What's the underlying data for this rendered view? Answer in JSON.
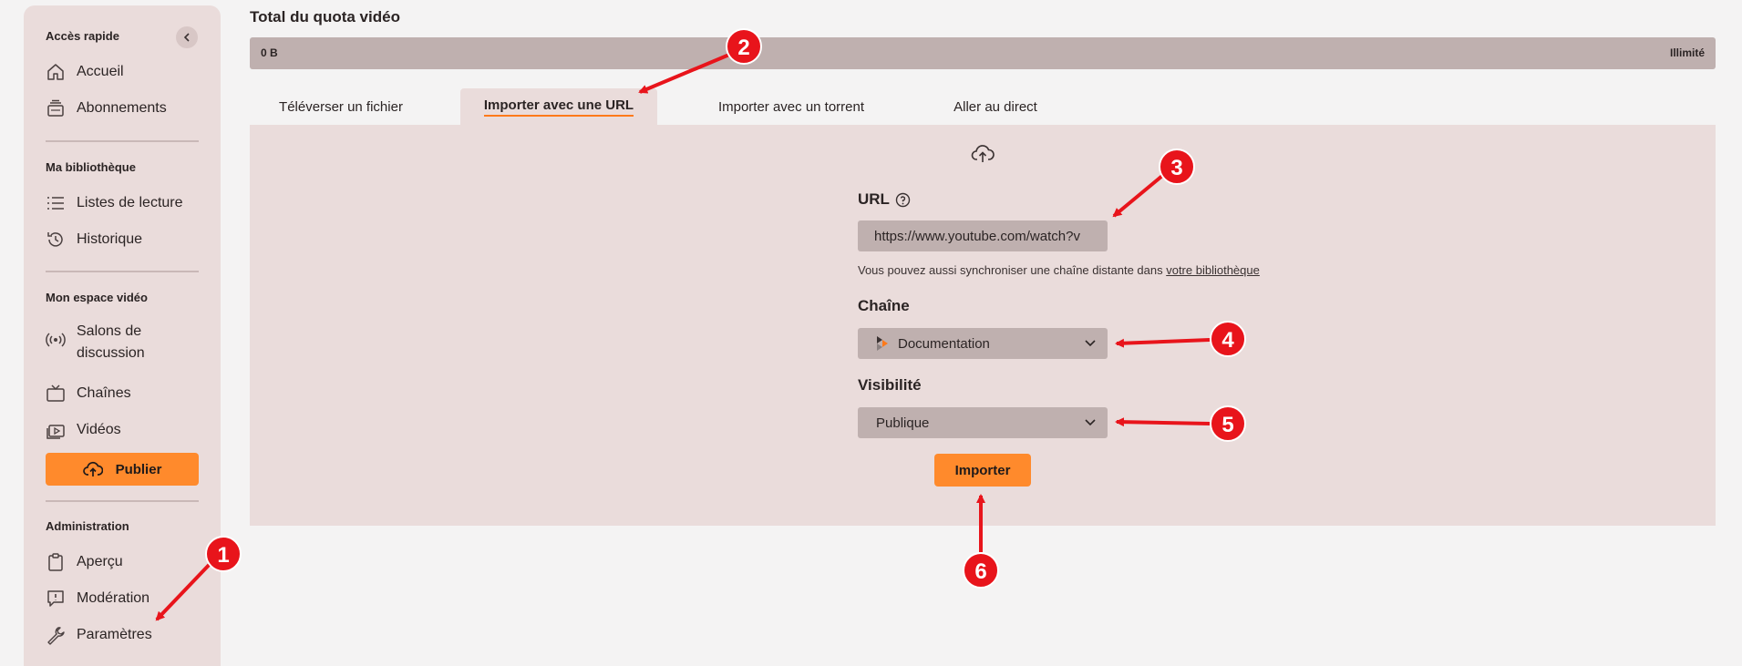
{
  "sidebar": {
    "quick_access_title": "Accès rapide",
    "quick_items": [
      {
        "label": "Accueil",
        "icon": "home-icon"
      },
      {
        "label": "Abonnements",
        "icon": "subscriptions-icon"
      }
    ],
    "library_title": "Ma bibliothèque",
    "library_items": [
      {
        "label": "Listes de lecture",
        "icon": "list-icon"
      },
      {
        "label": "Historique",
        "icon": "history-icon"
      }
    ],
    "video_space_title": "Mon espace vidéo",
    "video_items": [
      {
        "label": "Salons de discussion",
        "icon": "broadcast-icon"
      },
      {
        "label": "Chaînes",
        "icon": "tv-icon"
      },
      {
        "label": "Vidéos",
        "icon": "video-icon"
      }
    ],
    "publish_label": "Publier",
    "admin_title": "Administration",
    "admin_items": [
      {
        "label": "Aperçu",
        "icon": "clipboard-icon"
      },
      {
        "label": "Modération",
        "icon": "moderation-icon"
      },
      {
        "label": "Paramètres",
        "icon": "wrench-icon"
      }
    ]
  },
  "quota": {
    "title": "Total du quota vidéo",
    "used": "0 B",
    "max": "Illimité"
  },
  "tabs": [
    {
      "label": "Téléverser un fichier",
      "active": false
    },
    {
      "label": "Importer avec une URL",
      "active": true
    },
    {
      "label": "Importer avec un torrent",
      "active": false
    },
    {
      "label": "Aller au direct",
      "active": false
    }
  ],
  "form": {
    "url_label": "URL",
    "url_value": "https://www.youtube.com/watch?v",
    "hint_text": "Vous pouvez aussi synchroniser une chaîne distante dans ",
    "hint_link": "votre bibliothèque",
    "channel_label": "Chaîne",
    "channel_value": "Documentation",
    "visibility_label": "Visibilité",
    "visibility_value": "Publique",
    "import_label": "Importer"
  },
  "annotations": {
    "badges": [
      "1",
      "2",
      "3",
      "4",
      "5",
      "6"
    ],
    "color": "#e8141b"
  },
  "colors": {
    "accent": "#ff8a2c",
    "sidebar_bg": "#eadcdb",
    "field_bg": "#bfb0af"
  }
}
